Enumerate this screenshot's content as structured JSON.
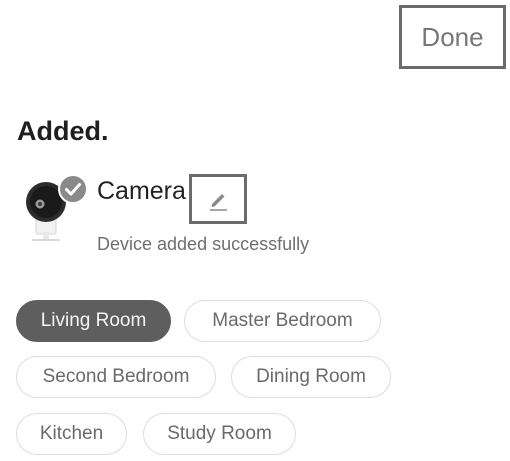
{
  "header": {
    "done_label": "Done"
  },
  "main": {
    "title": "Added."
  },
  "device": {
    "name": "Camera",
    "status": "Device added successfully",
    "icon": "camera-icon",
    "badge_icon": "check-icon",
    "edit_icon": "pencil-icon"
  },
  "rooms": {
    "selected": "Living Room",
    "items": [
      {
        "label": "Living Room"
      },
      {
        "label": "Master Bedroom"
      },
      {
        "label": "Second Bedroom"
      },
      {
        "label": "Dining Room"
      },
      {
        "label": "Kitchen"
      },
      {
        "label": "Study Room"
      }
    ]
  },
  "colors": {
    "selected_chip": "#5e5e5e",
    "chip_border": "#dddddd",
    "highlight_box": "#6b6b6b"
  }
}
